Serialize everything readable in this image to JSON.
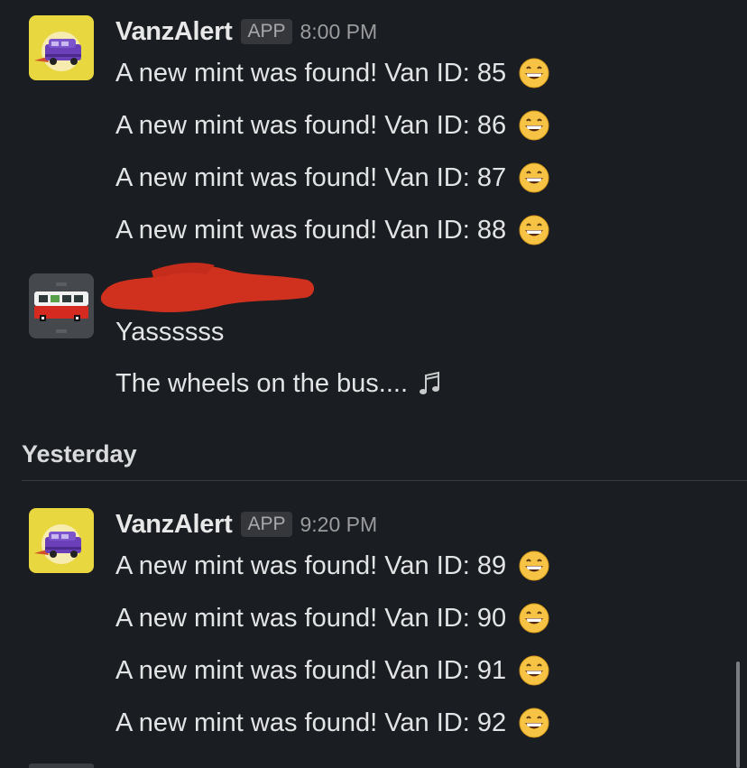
{
  "groups": [
    {
      "sender": "VanzAlert",
      "badge": "APP",
      "time": "8:00 PM",
      "avatar": "van-logo-yellow",
      "messages": [
        "A new mint was found! Van ID: 85",
        "A new mint was found! Van ID: 86",
        "A new mint was found! Van ID: 87",
        "A new mint was found! Van ID: 88"
      ],
      "emoji": "grinning-face-icon"
    },
    {
      "sender": "",
      "avatar": "bus-pixel-art",
      "messages": [
        "Yassssss",
        "The wheels on the bus...."
      ],
      "emoji": "music-notes-icon"
    },
    {
      "sender": "VanzAlert",
      "badge": "APP",
      "time": "9:20 PM",
      "avatar": "van-logo-yellow",
      "messages": [
        "A new mint was found! Van ID: 89",
        "A new mint was found! Van ID: 90",
        "A new mint was found! Van ID: 91",
        "A new mint was found! Van ID: 92"
      ],
      "emoji": "grinning-face-icon"
    }
  ],
  "day_divider": "Yesterday",
  "colors": {
    "background": "#1a1d21",
    "text": "#e3e4e5",
    "redaction": "#d0311f",
    "avatar_yellow": "#e8d73e",
    "avatar_gray": "#45484d"
  }
}
